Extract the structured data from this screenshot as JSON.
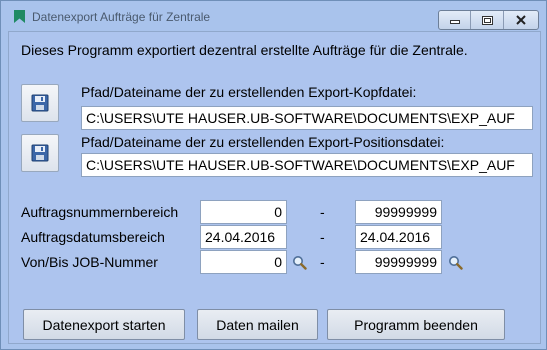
{
  "window": {
    "title": "Datenexport Aufträge für Zentrale",
    "icon": "bookmark-icon",
    "controls": [
      "minimize-icon",
      "maximize-icon",
      "close-icon"
    ]
  },
  "intro": "Dieses Programm exportiert dezentral erstellte Aufträge für die Zentrale.",
  "export_head": {
    "label": "Pfad/Dateiname der zu erstellenden Export-Kopfdatei:",
    "value": "C:\\USERS\\UTE HAUSER.UB-SOFTWARE\\DOCUMENTS\\EXP_AUF",
    "icon": "floppy-disk-icon"
  },
  "export_pos": {
    "label": "Pfad/Dateiname der zu erstellenden Export-Positionsdatei:",
    "value": "C:\\USERS\\UTE HAUSER.UB-SOFTWARE\\DOCUMENTS\\EXP_AUF",
    "icon": "floppy-disk-icon"
  },
  "ranges": [
    {
      "label": "Auftragsnummernbereich",
      "from": "0",
      "to": "99999999",
      "search": false
    },
    {
      "label": "Auftragsdatumsbereich",
      "from": "24.04.2016",
      "to": "24.04.2016",
      "search": false
    },
    {
      "label": "Von/Bis JOB-Nummer",
      "from": "0",
      "to": "99999999",
      "search": true
    }
  ],
  "range_separator": "-",
  "buttons": {
    "start": "Datenexport starten",
    "mail": "Daten mailen",
    "exit": "Programm beenden"
  },
  "colors": {
    "window_bg": "#a9c3ec",
    "client_bg": "#adc4ee",
    "title_text": "#4a5a6e",
    "icon_green": "#1f8a64"
  }
}
